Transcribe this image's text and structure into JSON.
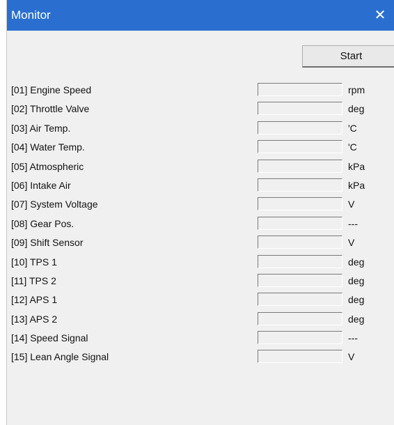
{
  "window": {
    "title": "Monitor",
    "close_glyph": "✕"
  },
  "toolbar": {
    "start_label": "Start"
  },
  "monitor_rows": [
    {
      "label": "[01] Engine Speed",
      "value": "",
      "unit": "rpm"
    },
    {
      "label": "[02] Throttle Valve",
      "value": "",
      "unit": "deg"
    },
    {
      "label": "[03] Air Temp.",
      "value": "",
      "unit": "'C"
    },
    {
      "label": "[04] Water Temp.",
      "value": "",
      "unit": "'C"
    },
    {
      "label": "[05] Atmospheric",
      "value": "",
      "unit": "kPa"
    },
    {
      "label": "[06] Intake Air",
      "value": "",
      "unit": "kPa"
    },
    {
      "label": "[07] System Voltage",
      "value": "",
      "unit": "V"
    },
    {
      "label": "[08] Gear Pos.",
      "value": "",
      "unit": "---"
    },
    {
      "label": "[09] Shift Sensor",
      "value": "",
      "unit": "V"
    },
    {
      "label": "[10] TPS 1",
      "value": "",
      "unit": "deg"
    },
    {
      "label": "[11] TPS 2",
      "value": "",
      "unit": "deg"
    },
    {
      "label": "[12] APS 1",
      "value": "",
      "unit": "deg"
    },
    {
      "label": "[13] APS 2",
      "value": "",
      "unit": "deg"
    },
    {
      "label": "[14] Speed Signal",
      "value": "",
      "unit": "---"
    },
    {
      "label": "[15] Lean Angle Signal",
      "value": "",
      "unit": "V"
    }
  ],
  "colors": {
    "titlebar": "#2a6fcf",
    "window_background": "#f0f0f0"
  }
}
